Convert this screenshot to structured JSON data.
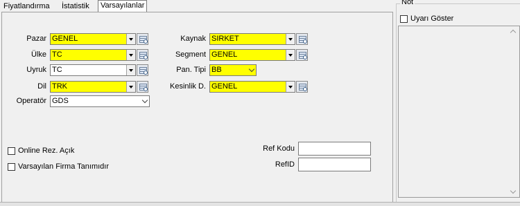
{
  "tabs": [
    {
      "label": "Fiyatlandırma",
      "active": false
    },
    {
      "label": "İstatistik",
      "active": false
    },
    {
      "label": "Varsayılanlar",
      "active": true
    }
  ],
  "left_fields": [
    {
      "label": "Pazar",
      "value": "GENEL",
      "highlight": true,
      "lookup": true
    },
    {
      "label": "Ülke",
      "value": "TC",
      "highlight": true,
      "lookup": true
    },
    {
      "label": "Uyruk",
      "value": "TC",
      "highlight": false,
      "lookup": true
    },
    {
      "label": "Dil",
      "value": "TRK",
      "highlight": true,
      "lookup": true
    },
    {
      "label": "Operatör",
      "value": "GDS",
      "highlight": false,
      "lookup": false
    }
  ],
  "right_fields": [
    {
      "label": "Kaynak",
      "value": "SIRKET",
      "highlight": true,
      "lookup": true
    },
    {
      "label": "Segment",
      "value": "GENEL",
      "highlight": true,
      "lookup": true
    },
    {
      "label": "Pan. Tipi",
      "value": "BB",
      "highlight": true,
      "lookup": false
    },
    {
      "label": "Kesinlik D.",
      "value": "GENEL",
      "highlight": true,
      "lookup": true
    }
  ],
  "checkboxes": {
    "online_rez": {
      "label": "Online Rez. Açık",
      "checked": false
    },
    "varsayilan_firma": {
      "label": "Varsayılan Firma Tanımıdır",
      "checked": false
    }
  },
  "ref": {
    "kodu_label": "Ref Kodu",
    "kodu_value": "",
    "id_label": "RefID",
    "id_value": ""
  },
  "note": {
    "title": "Not",
    "uyari_label": "Uyarı Göster",
    "uyari_checked": false,
    "text": ""
  },
  "colors": {
    "highlight": "#ffff00",
    "window_bg": "#f0f0f0"
  }
}
